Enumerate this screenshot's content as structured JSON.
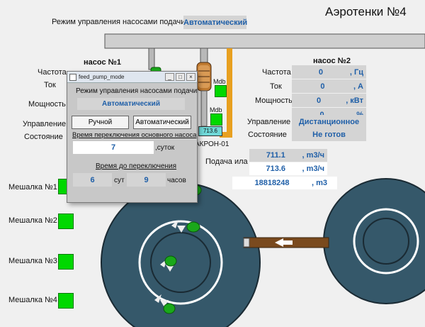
{
  "header": {
    "title": "Аэротенки №4",
    "mode_label": "Режим управления насосами подачи",
    "mode_value": "Автоматический"
  },
  "pump1": {
    "title": "насос №1",
    "labels": {
      "freq": "Частота",
      "current": "Ток",
      "power": "Мощность",
      "control": "Управление",
      "state": "Состояние"
    }
  },
  "pump2": {
    "title": "насос №2",
    "rows": [
      {
        "label": "Частота",
        "value": "0",
        "unit": ", Гц"
      },
      {
        "label": "Ток",
        "value": "0",
        "unit": ", А"
      },
      {
        "label": "Мощность",
        "value": "0",
        "unit": ", кВт"
      },
      {
        "label": "",
        "value": "0",
        "unit": ", %"
      }
    ],
    "control_label": "Управление",
    "control_value": "Дистанционное",
    "state_label": "Состояние",
    "state_value": "Не готов"
  },
  "equipment": {
    "mdb1": "Mdb",
    "mdb2": "Mdb",
    "flow_display": "713.6",
    "akron_label": "АКРОН-01"
  },
  "flow": {
    "label": "Подача ила",
    "value1": "711.1",
    "unit1": ", m3/ч",
    "value2": "713.6",
    "unit2": ", m3/ч",
    "total": "18818248",
    "total_unit": ", m3"
  },
  "mixers": [
    "Мешалка №1",
    "Мешалка №2",
    "Мешалка №3",
    "Мешалка №4"
  ],
  "dialog": {
    "window_title": "feed_pump_mode",
    "mode_heading": "Режим управления насосами подачи",
    "mode_value": "Автоматический",
    "manual_button": "Ручной",
    "auto_button": "Автоматический",
    "switch_time_label": "Время переключения основного насоса",
    "switch_time_value": "7",
    "switch_time_unit": ",суток",
    "remaining_label": "Время до переключения",
    "days_value": "6",
    "days_unit": "сут",
    "hours_value": "9",
    "hours_unit": "часов"
  },
  "colors": {
    "tank": "#35586a",
    "mixer_green": "#00d800",
    "value_text": "#1f5fa8",
    "pipe_orange": "#e8a020"
  }
}
